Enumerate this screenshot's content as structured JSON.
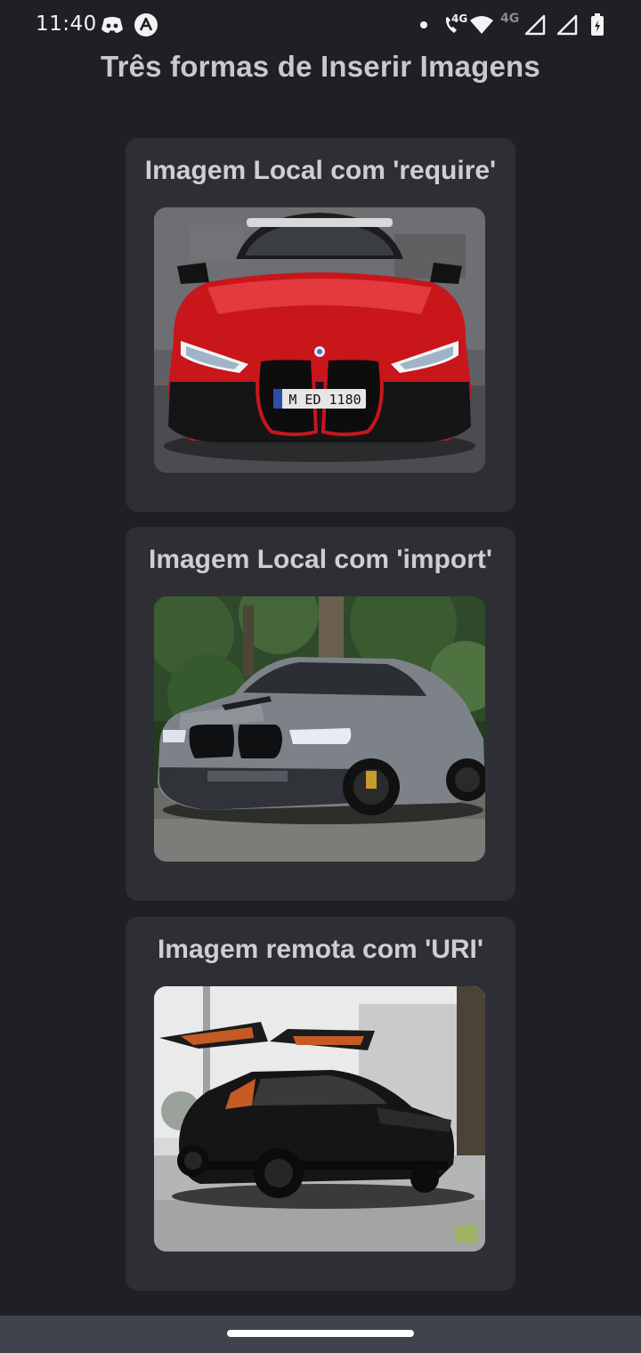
{
  "status_bar": {
    "time": "11:40",
    "network_1": "4G",
    "network_2": "4G",
    "icons": [
      "discord-icon",
      "app-icon",
      "notification-dot-icon",
      "wifi-calling-icon",
      "wifi-icon",
      "signal-icon",
      "signal-icon",
      "battery-icon"
    ]
  },
  "page": {
    "title": "Três formas de Inserir Imagens"
  },
  "cards": [
    {
      "title": "Imagem Local com 'require'",
      "image_alt": "red sports car front view",
      "accent": "#c8161b"
    },
    {
      "title": "Imagem Local com 'import'",
      "image_alt": "grey SUV in forest",
      "accent": "#7d8288"
    },
    {
      "title": "Imagem remota com 'URI'",
      "image_alt": "black SUV with open falcon doors",
      "accent": "#151515"
    }
  ],
  "colors": {
    "background": "#1f2025",
    "card": "#2e2f35",
    "nav_bar": "#3f434b",
    "text": "#cfcfcf"
  }
}
